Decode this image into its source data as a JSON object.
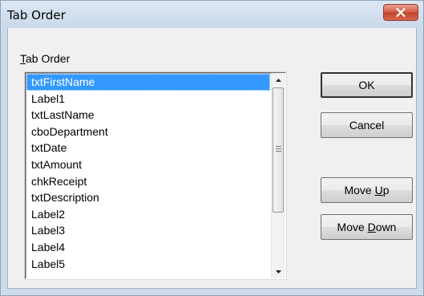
{
  "window": {
    "title": "Tab Order"
  },
  "label": {
    "prefix": "",
    "mnemonic": "T",
    "rest": "ab Order"
  },
  "list": {
    "items": [
      "txtFirstName",
      "Label1",
      "txtLastName",
      "cboDepartment",
      "txtDate",
      "txtAmount",
      "chkReceipt",
      "txtDescription",
      "Label2",
      "Label3",
      "Label4",
      "Label5"
    ],
    "selected_index": 0
  },
  "buttons": {
    "ok": "OK",
    "cancel": "Cancel",
    "move_up": {
      "prefix": "Move ",
      "mnemonic": "U",
      "rest": "p"
    },
    "move_down": {
      "prefix": "Move ",
      "mnemonic": "D",
      "rest": "own"
    }
  },
  "icons": {
    "close": "close-icon",
    "scroll_up": "arrow-up-icon",
    "scroll_down": "arrow-down-icon",
    "thumb_grip": "grip-icon"
  },
  "colors": {
    "selection": "#3399ff",
    "close_button": "#c2432b",
    "title_bar": "#cfdbea"
  }
}
